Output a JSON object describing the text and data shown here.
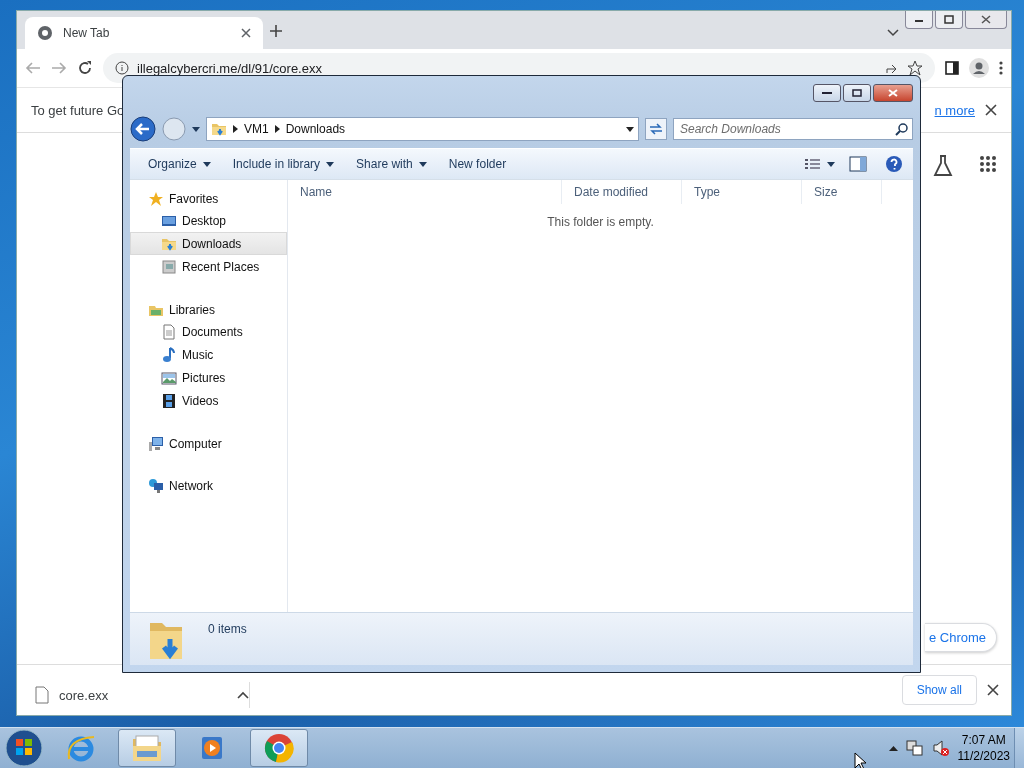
{
  "browser": {
    "tabs": [
      {
        "title": "New Tab",
        "selected": true
      }
    ],
    "address": "illegalcybercri.me/dl/91/core.exx",
    "infobar": {
      "text": "To get future Go",
      "link": "n more"
    },
    "content": {
      "button": "e Chrome"
    },
    "downloads": [
      {
        "file": "core.exx"
      }
    ],
    "show_all": "Show all"
  },
  "explorer": {
    "breadcrumb": [
      "VM1",
      "Downloads"
    ],
    "search": {
      "placeholder": "Search Downloads"
    },
    "toolbar": [
      {
        "label": "Organize",
        "dropdown": true
      },
      {
        "label": "Include in library",
        "dropdown": true
      },
      {
        "label": "Share with",
        "dropdown": true
      },
      {
        "label": "New folder",
        "dropdown": false
      }
    ],
    "nav": [
      {
        "label": "Favorites",
        "items": [
          {
            "label": "Desktop",
            "selected": false
          },
          {
            "label": "Downloads",
            "selected": true
          },
          {
            "label": "Recent Places",
            "selected": false
          }
        ]
      },
      {
        "label": "Libraries",
        "items": [
          {
            "label": "Documents",
            "selected": false
          },
          {
            "label": "Music",
            "selected": false
          },
          {
            "label": "Pictures",
            "selected": false
          },
          {
            "label": "Videos",
            "selected": false
          }
        ]
      },
      {
        "label": "Computer"
      },
      {
        "label": "Network"
      }
    ],
    "columns": [
      "Name",
      "Date modified",
      "Type",
      "Size"
    ],
    "empty_message": "This folder is empty.",
    "status": "0 items"
  },
  "taskbar": {
    "apps": [
      {
        "kind": "ie",
        "active": false
      },
      {
        "kind": "explorer",
        "active": true
      },
      {
        "kind": "media",
        "active": false
      },
      {
        "kind": "chrome",
        "active": true
      }
    ],
    "time": "7:07 AM",
    "date": "11/2/2023"
  }
}
